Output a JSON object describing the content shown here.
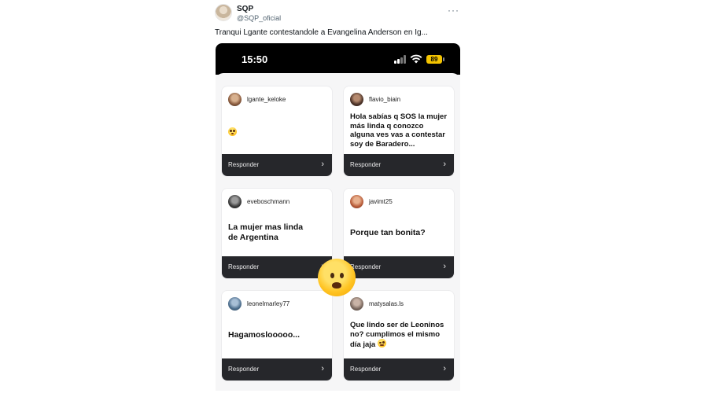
{
  "tweet": {
    "display_name": "SQP",
    "handle": "@SQP_oficial",
    "more_icon": "more-dots-icon",
    "text": "Tranqui Lgante contestandole a Evangelina Anderson en Ig..."
  },
  "phone": {
    "time": "15:50",
    "battery": "89",
    "status_icons": [
      "signal-icon",
      "wifi-icon",
      "battery-icon"
    ]
  },
  "cards": [
    {
      "username": "lgante_keloke",
      "message": "",
      "emoji": "pleading-face",
      "reply_label": "Responder",
      "avatar_color": "#b88a6a"
    },
    {
      "username": "flavio_biain",
      "message": "Hola sabías q SOS la mujer más linda q conozco alguna ves vas a contestar soy de Baradero...",
      "reply_label": "Responder",
      "avatar_color": "#6b4a3d"
    },
    {
      "username": "eveboschmann",
      "message": "La mujer mas linda de Argentina",
      "reply_label": "Responder",
      "avatar_color": "#444"
    },
    {
      "username": "javimt25",
      "message": "Porque tan bonita?",
      "reply_label": "Responder",
      "avatar_color": "#c06a48"
    },
    {
      "username": "leonelmarley77",
      "message": "Hagamoslooooo...",
      "reply_label": "Responder",
      "avatar_color": "#4e6f8e"
    },
    {
      "username": "matysalas.ls",
      "message": "Que lindo ser de Leoninos no? cumplimos el mismo día jaja",
      "emoji": "winking-face",
      "reply_label": "Responder",
      "avatar_color": "#7c6a60"
    }
  ],
  "overlay_emoji": "surprised-face"
}
